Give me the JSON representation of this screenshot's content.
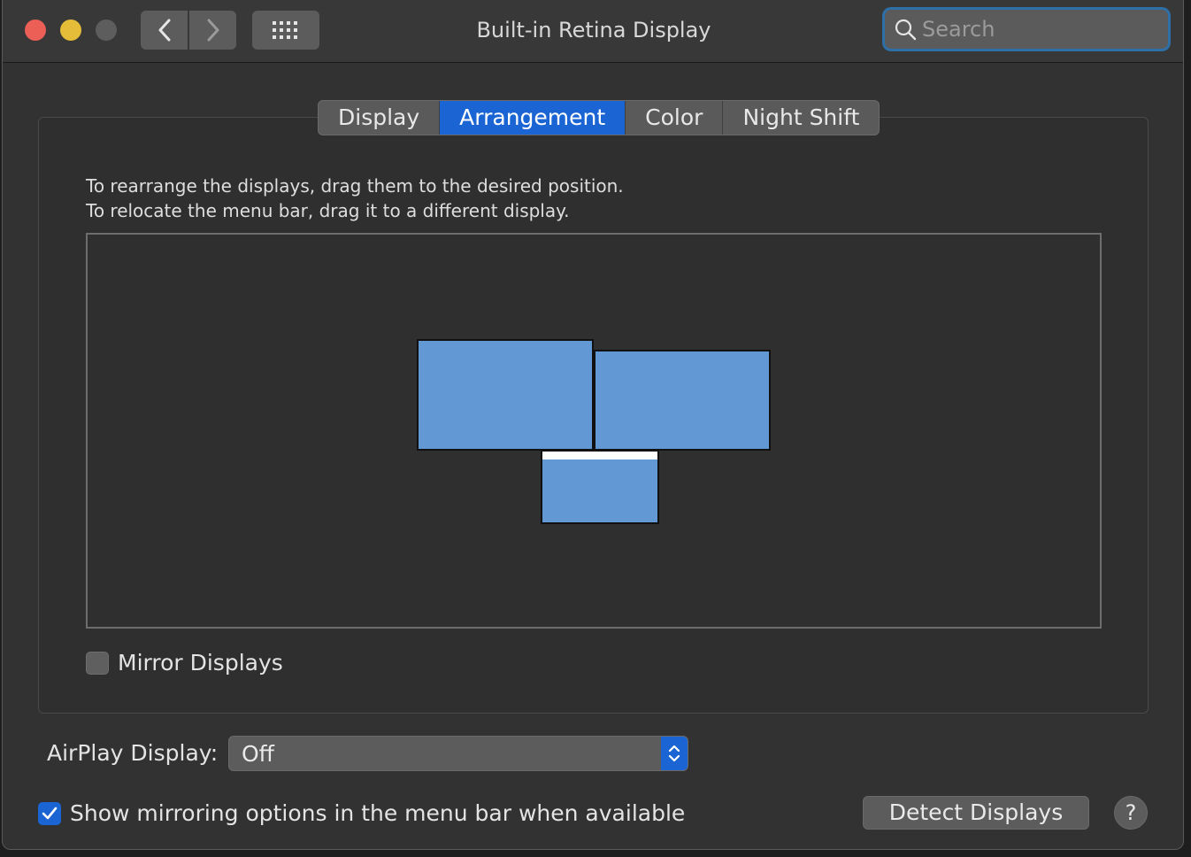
{
  "window": {
    "title": "Built-in Retina Display"
  },
  "search": {
    "placeholder": "Search"
  },
  "tabs": [
    {
      "label": "Display",
      "active": false
    },
    {
      "label": "Arrangement",
      "active": true
    },
    {
      "label": "Color",
      "active": false
    },
    {
      "label": "Night Shift",
      "active": false
    }
  ],
  "arrangement": {
    "instruction_line1": "To rearrange the displays, drag them to the desired position.",
    "instruction_line2": "To relocate the menu bar, drag it to a different display.",
    "display_color": "#6299d4",
    "mirror_label": "Mirror Displays",
    "mirror_checked": false
  },
  "airplay": {
    "label": "AirPlay Display:",
    "selected": "Off"
  },
  "footer": {
    "show_mirroring_label": "Show mirroring options in the menu bar when available",
    "show_mirroring_checked": true,
    "detect_button": "Detect Displays",
    "help_button": "?"
  },
  "colors": {
    "accent": "#1a65d3",
    "window_bg": "#323232"
  }
}
